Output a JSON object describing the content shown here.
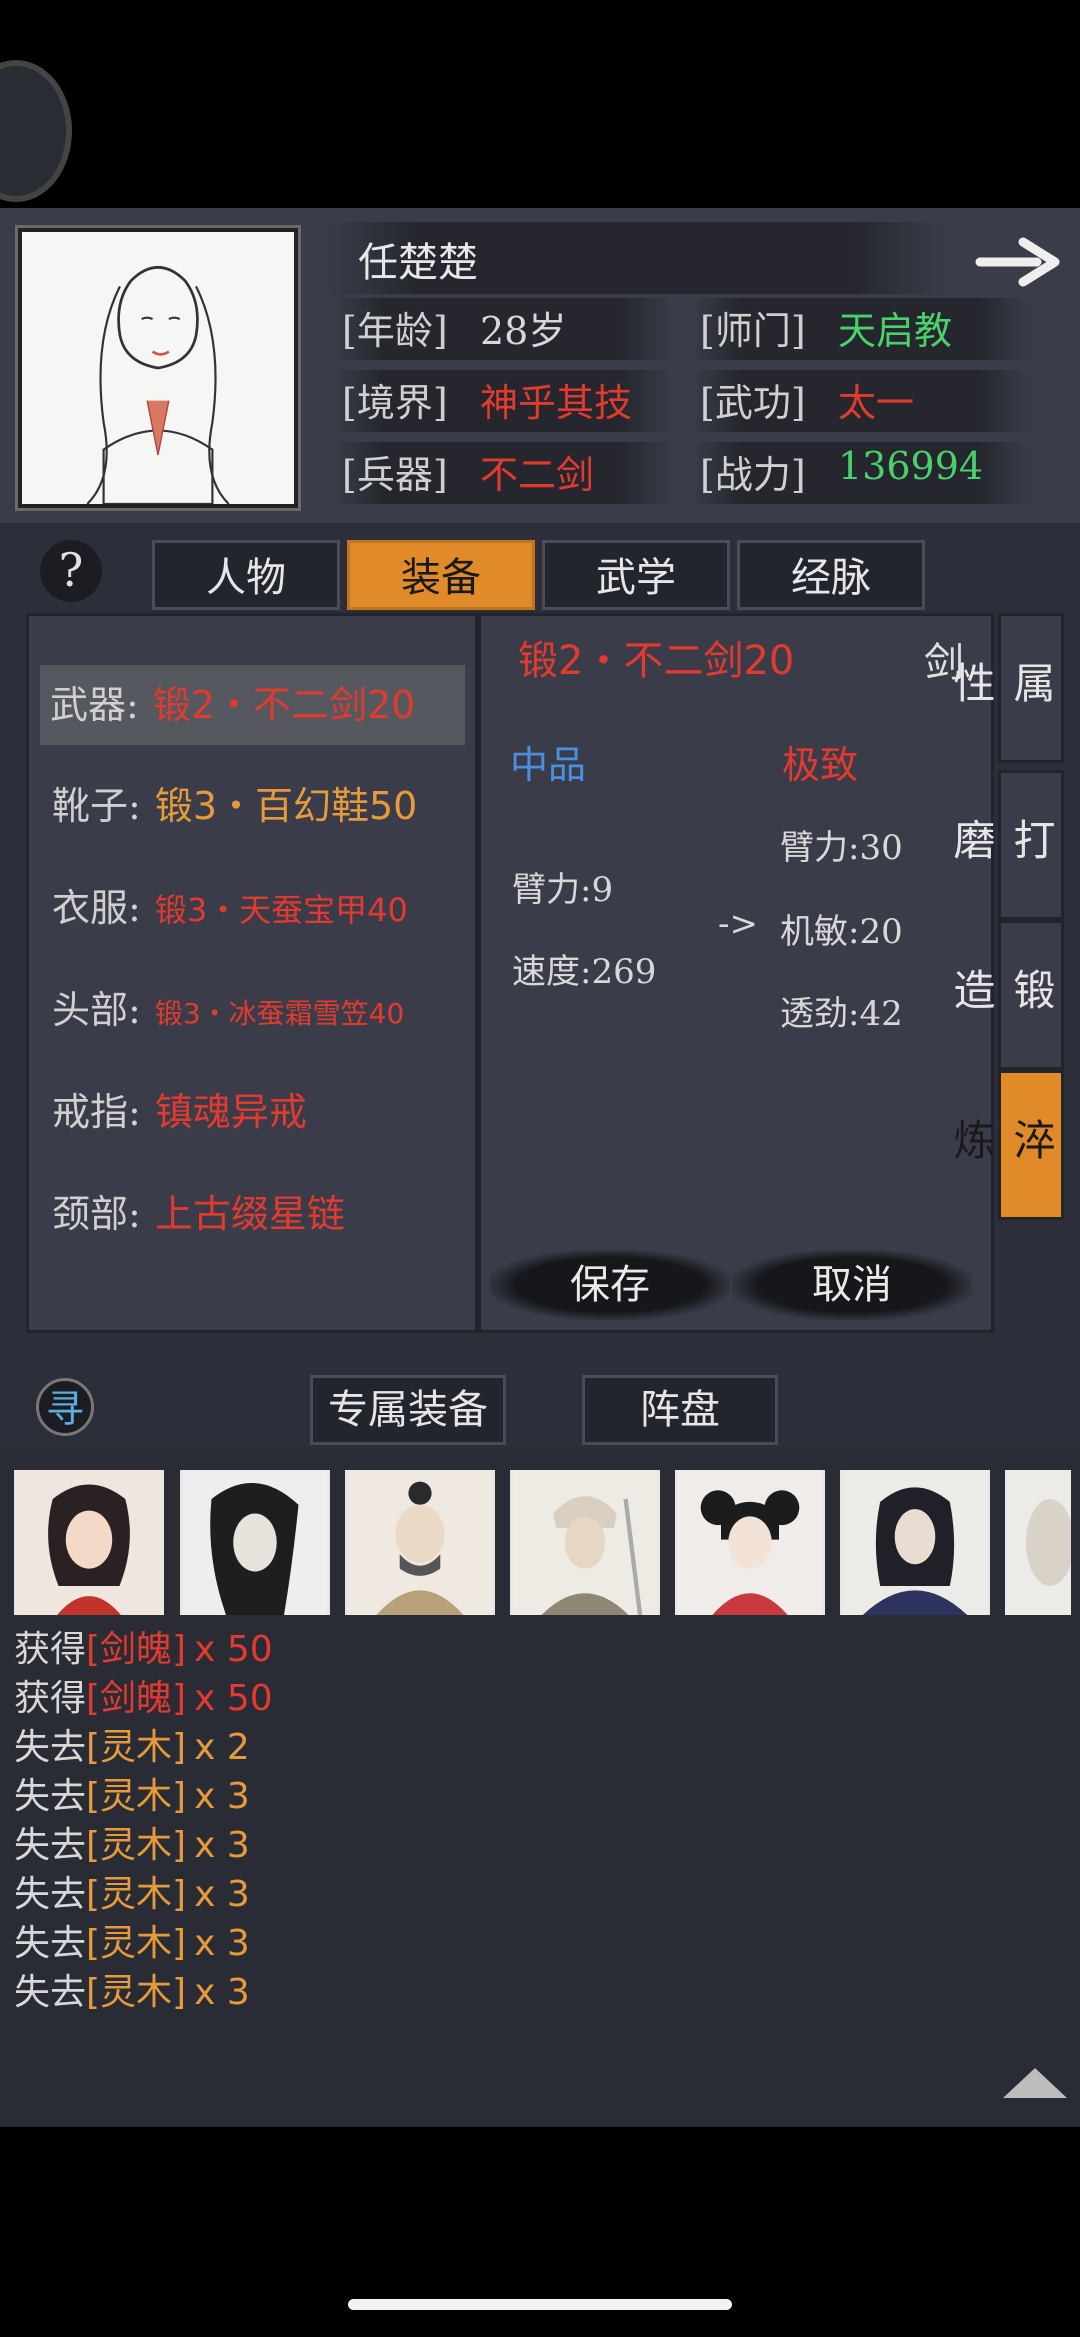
{
  "character": {
    "name": "任楚楚",
    "info": [
      {
        "label": "[年龄]",
        "value": "28岁",
        "color": "#d8d8d8"
      },
      {
        "label": "[师门]",
        "value": "天启教",
        "color": "#49d26a"
      },
      {
        "label": "[境界]",
        "value": "神乎其技",
        "color": "#e23a2e"
      },
      {
        "label": "[武功]",
        "value": "太一",
        "color": "#e23a2e"
      },
      {
        "label": "[兵器]",
        "value": "不二剑",
        "color": "#e23a2e"
      },
      {
        "label": "[战力]",
        "value": "136994",
        "color": "#49d26a"
      }
    ]
  },
  "tabs": {
    "help": "?",
    "items": [
      "人物",
      "装备",
      "武学",
      "经脉"
    ],
    "active": "装备"
  },
  "equipment": [
    {
      "label": "武器:",
      "value": "锻2・不二剑20",
      "color": "#e23a2e",
      "selected": true
    },
    {
      "label": "靴子:",
      "value": "锻3・百幻鞋50",
      "color": "#e69a3c"
    },
    {
      "label": "衣服:",
      "value": "锻3・天蚕宝甲40",
      "color": "#e23a2e"
    },
    {
      "label": "头部:",
      "value": "锻3・冰蚕霜雪笠40",
      "color": "#e23a2e"
    },
    {
      "label": "戒指:",
      "value": "镇魂异戒",
      "color": "#e23a2e"
    },
    {
      "label": "颈部:",
      "value": "上古缀星链",
      "color": "#e23a2e"
    }
  ],
  "detail": {
    "item_name": "锻2・不二剑20",
    "item_type": "剑",
    "left_grade": "中品",
    "right_grade": "极致",
    "left_stats": [
      "臂力:9",
      "速度:269"
    ],
    "arrow": "->",
    "right_stats": [
      "臂力:30",
      "机敏:20",
      "透劲:42"
    ],
    "save": "保存",
    "cancel": "取消"
  },
  "side_tabs": [
    {
      "label": "属性",
      "active": false
    },
    {
      "label": "打磨",
      "active": false
    },
    {
      "label": "锻造",
      "active": false
    },
    {
      "label": "淬炼",
      "active": true
    }
  ],
  "bottom_tabs": {
    "search_icon": "寻",
    "exclusive": "专属装备",
    "formation": "阵盘"
  },
  "log": [
    {
      "verb": "获得",
      "item": "[剑魄]",
      "count": "x 50",
      "color": "#e23a2e"
    },
    {
      "verb": "获得",
      "item": "[剑魄]",
      "count": "x 50",
      "color": "#e23a2e"
    },
    {
      "verb": "失去",
      "item": "[灵木]",
      "count": "x 2",
      "color": "#e69a3c"
    },
    {
      "verb": "失去",
      "item": "[灵木]",
      "count": "x 3",
      "color": "#e69a3c"
    },
    {
      "verb": "失去",
      "item": "[灵木]",
      "count": "x 3",
      "color": "#e69a3c"
    },
    {
      "verb": "失去",
      "item": "[灵木]",
      "count": "x 3",
      "color": "#e69a3c"
    },
    {
      "verb": "失去",
      "item": "[灵木]",
      "count": "x 3",
      "color": "#e69a3c"
    },
    {
      "verb": "失去",
      "item": "[灵木]",
      "count": "x 3",
      "color": "#e69a3c"
    }
  ]
}
